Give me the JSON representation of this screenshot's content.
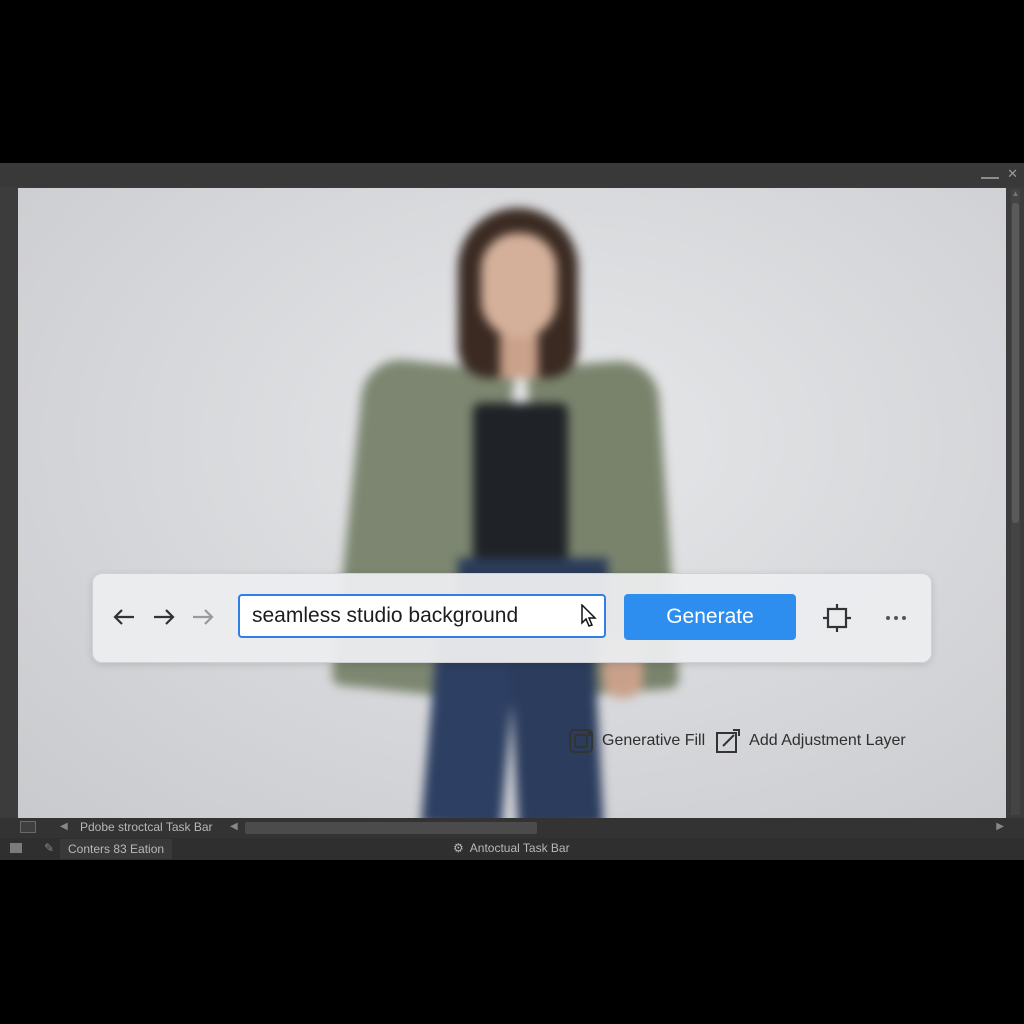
{
  "canvas": {
    "image_alt": "Woman in green blazer against studio background"
  },
  "contextual_actions": {
    "generative_fill_label": "Generative Fill",
    "add_adjustment_layer_label": "Add Adjustment Layer"
  },
  "taskbar": {
    "prompt_value": "seamless studio background",
    "generate_label": "Generate",
    "icons": [
      "back-arrow-icon",
      "forward-arrow-icon",
      "forward-arrow-disabled-icon",
      "crop-icon",
      "more-options-icon"
    ]
  },
  "bottom_bar": {
    "contextual_label": "Pdobe stroctcal Task Bar",
    "contents_label": "Conters 83 Eation",
    "center_label": "Antoctual Task Bar"
  },
  "colors": {
    "accent": "#2d8ef0",
    "window_bg": "#3c3c3c",
    "canvas_bg": "#d6d7da"
  }
}
